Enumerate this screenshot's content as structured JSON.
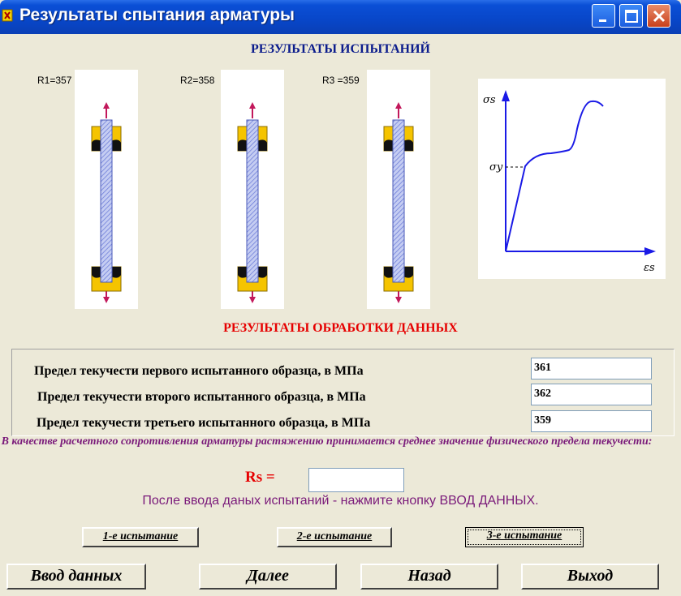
{
  "window": {
    "title": "Результаты спытания арматуры"
  },
  "header_results": "РЕЗУЛЬТАТЫ ИСПЫТАНИЙ",
  "specimens": [
    {
      "label": "R1=357"
    },
    {
      "label": "R2=358"
    },
    {
      "label": "R3 =359"
    }
  ],
  "graph": {
    "y_axis_label": "σs",
    "yield_label": "σy",
    "x_axis_label": "εs"
  },
  "header_processing": "РЕЗУЛЬТАТЫ ОБРАБОТКИ ДАННЫХ",
  "rows": [
    {
      "label": "Предел текучести первого испытанного образца, в МПа",
      "value": "361"
    },
    {
      "label": "Предел текучести второго испытанного образца, в МПа",
      "value": "362"
    },
    {
      "label": "Предел текучести третьего испытанного образца, в МПа",
      "value": "359"
    }
  ],
  "note": "В качестве расчетного сопротивления арматуры растяжению принимается среднее значение физического предела текучести:",
  "rs": {
    "label": "Rs =",
    "value": ""
  },
  "hint": "После ввода даных испытаний - нажмите кнопку ВВОД ДАННЫХ.",
  "test_buttons": [
    "1-е испытание",
    "2-е испытание",
    "3-е испытание"
  ],
  "buttons": {
    "enter": "Ввод данных",
    "next": "Далее",
    "back": "Назад",
    "exit": "Выход"
  },
  "colors": {
    "title_bar": "#0a4fd6",
    "header_blue": "#0b1c8c",
    "header_red": "#e60000",
    "note_purple": "#7a1a7a",
    "grip_yellow": "#f5c400",
    "rod": "#9aa7e8",
    "arrow": "#c2185b",
    "axis": "#1a1ae6"
  }
}
